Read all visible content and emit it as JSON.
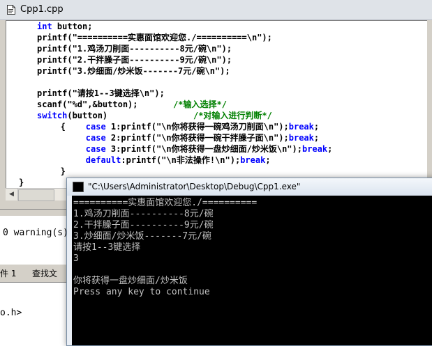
{
  "editor": {
    "title": "Cpp1.cpp",
    "code_lines": [
      [
        [
          "kw",
          "int"
        ],
        [
          "tx",
          " button;"
        ]
      ],
      [
        [
          "tx",
          "printf(\"==========实惠面馆欢迎您./==========\\n\");"
        ]
      ],
      [
        [
          "tx",
          "printf(\"1.鸡汤刀削面----------8元/碗\\n\");"
        ]
      ],
      [
        [
          "tx",
          "printf(\"2.干拌臊子面----------9元/碗\\n\");"
        ]
      ],
      [
        [
          "tx",
          "printf(\"3.炒细面/炒米饭-------7元/碗\\n\");"
        ]
      ],
      [],
      [
        [
          "tx",
          "printf(\"请按1--3键选择\\n\");"
        ]
      ],
      [
        [
          "tx",
          "scanf(\"%d\",&button);       "
        ],
        [
          "cm",
          "/*输入选择*/"
        ]
      ],
      [
        [
          "kw",
          "switch"
        ],
        [
          "tx",
          "(button)                 "
        ],
        [
          "cm",
          "/*对输入进行判断*/"
        ]
      ],
      [
        [
          "tx",
          "   {    "
        ],
        [
          "kw",
          "case"
        ],
        [
          "tx",
          " 1:printf(\"\\n你将获得一碗鸡汤刀削面\\n\");"
        ],
        [
          "kw",
          "break"
        ],
        [
          "tx",
          ";"
        ]
      ],
      [
        [
          "tx",
          "        "
        ],
        [
          "kw",
          "case"
        ],
        [
          "tx",
          " 2:printf(\"\\n你将获得一碗干拌臊子面\\n\");"
        ],
        [
          "kw",
          "break"
        ],
        [
          "tx",
          ";"
        ]
      ],
      [
        [
          "tx",
          "        "
        ],
        [
          "kw",
          "case"
        ],
        [
          "tx",
          " 3:printf(\"\\n你将获得一盘炒细面/炒米饭\\n\");"
        ],
        [
          "kw",
          "break"
        ],
        [
          "tx",
          ";"
        ]
      ],
      [
        [
          "tx",
          "        "
        ],
        [
          "kw",
          "default"
        ],
        [
          "tx",
          ":printf(\"\\n非法操作!\\n\");"
        ],
        [
          "kw",
          "break"
        ],
        [
          "tx",
          ";"
        ]
      ],
      [
        [
          "tx",
          "   }"
        ]
      ],
      [
        [
          "tx",
          "}"
        ]
      ]
    ]
  },
  "output": {
    "warning": "0 warning(s)",
    "tab_file": "件 1",
    "tab_find": "查找文",
    "status": "o.h>"
  },
  "console": {
    "title": "\"C:\\Users\\Administrator\\Desktop\\Debug\\Cpp1.exe\"",
    "lines": [
      "==========实惠面馆欢迎您./==========",
      "1.鸡汤刀削面----------8元/碗",
      "2.干拌臊子面----------9元/碗",
      "3.炒细面/炒米饭-------7元/碗",
      "请按1--3键选择",
      "3",
      "",
      "你将获得一盘炒细面/炒米饭",
      "Press any key to continue"
    ]
  }
}
